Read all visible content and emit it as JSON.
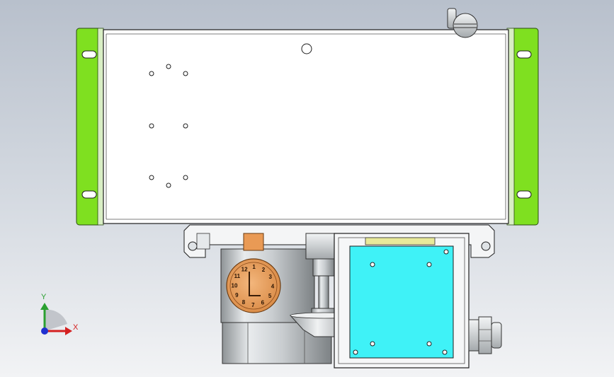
{
  "viewport": {
    "background_top": "#b8c0cc",
    "background_bottom": "#f2f3f5"
  },
  "colors": {
    "bracket_green": "#7fe020",
    "indicator_cyan": "#3ff2f7",
    "dial_orange": "#e99a55",
    "housing_silver": "#cfd3d6",
    "axis_x": "#d42020",
    "axis_y": "#2aa030",
    "axis_z": "#2030d0"
  },
  "dial": {
    "numbers": [
      "12",
      "1",
      "2",
      "3",
      "4",
      "5",
      "6",
      "7",
      "8",
      "9",
      "10",
      "11"
    ]
  },
  "triad": {
    "x_label": "X",
    "y_label": "Y"
  }
}
